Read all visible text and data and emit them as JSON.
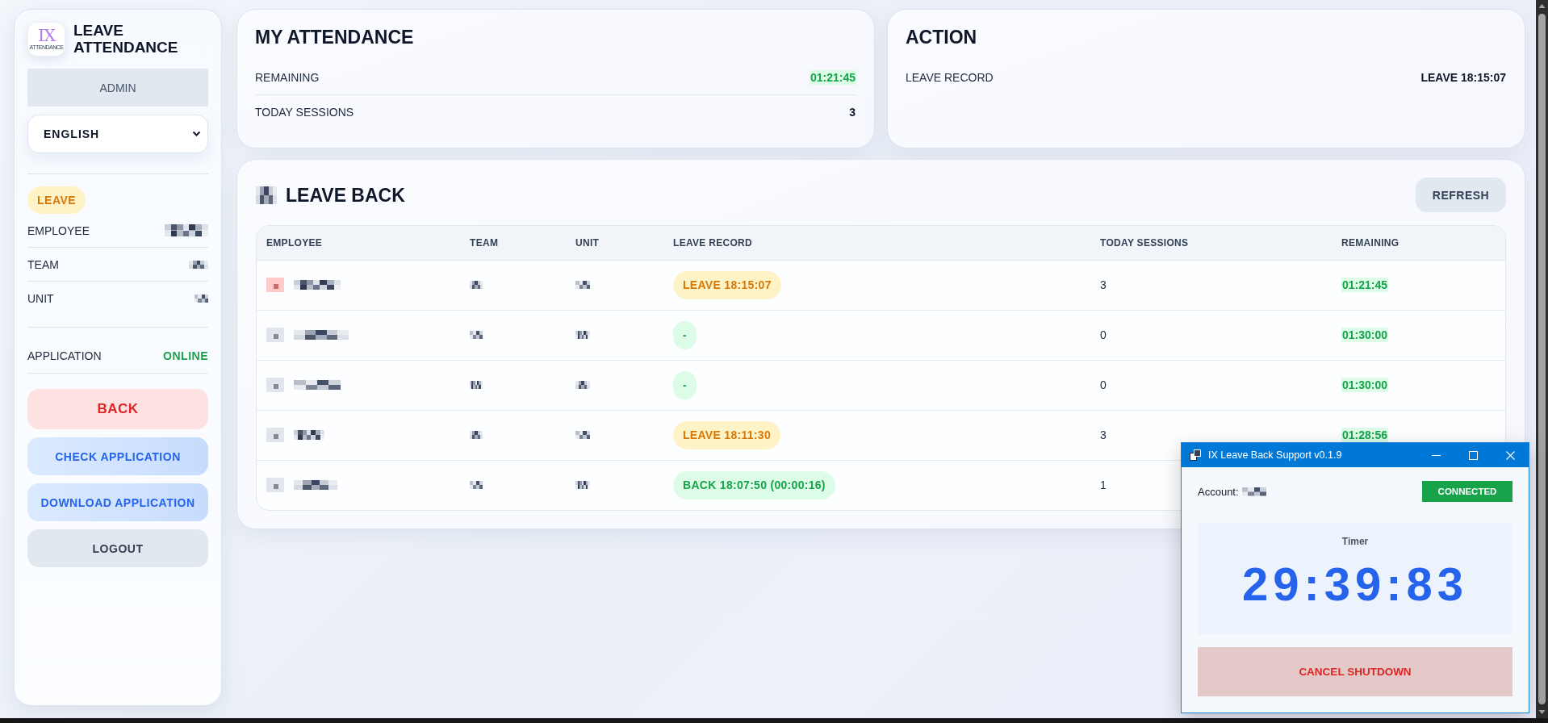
{
  "sidebar": {
    "logo": {
      "mark": "IX",
      "caption": "ATTENDANCE"
    },
    "title": "LEAVE ATTENDANCE",
    "role": "ADMIN",
    "language": "ENGLISH",
    "status_badge": {
      "label": "LEAVE",
      "kind": "leave"
    },
    "info_rows": [
      "EMPLOYEE",
      "TEAM",
      "UNIT"
    ],
    "application": {
      "label": "APPLICATION",
      "status": "ONLINE",
      "online": true
    },
    "buttons": [
      {
        "label": "BACK",
        "kind": "danger"
      },
      {
        "label": "CHECK APPLICATION",
        "kind": "primary"
      },
      {
        "label": "DOWNLOAD APPLICATION",
        "kind": "primary"
      },
      {
        "label": "LOGOUT",
        "kind": "neutral"
      }
    ]
  },
  "my_attendance": {
    "title": "MY ATTENDANCE",
    "rows": [
      {
        "label": "REMAINING",
        "value": "01:21:45",
        "kind": "time"
      },
      {
        "label": "TODAY SESSIONS",
        "value": "3",
        "kind": "count"
      }
    ]
  },
  "action": {
    "title": "ACTION",
    "rows": [
      {
        "label": "LEAVE RECORD",
        "value": "LEAVE 18:15:07",
        "kind": "text"
      }
    ]
  },
  "leave_back": {
    "title": "LEAVE BACK",
    "refresh_button": "REFRESH",
    "table": {
      "columns": [
        "EMPLOYEE",
        "TEAM",
        "UNIT",
        "LEAVE RECORD",
        "TODAY SESSIONS",
        "REMAINING"
      ],
      "rows": [
        {
          "avatar": {
            "color": "#fecaca"
          },
          "leave_record": {
            "text": "LEAVE 18:15:07",
            "kind": "leave"
          },
          "today_sessions": "3",
          "remaining": "01:21:45"
        },
        {
          "avatar": {
            "color": "#e2e5ec"
          },
          "leave_record": {
            "text": "-",
            "kind": "none"
          },
          "today_sessions": "0",
          "remaining": "01:30:00"
        },
        {
          "avatar": {
            "color": "#e2e5ec"
          },
          "leave_record": {
            "text": "-",
            "kind": "none"
          },
          "today_sessions": "0",
          "remaining": "01:30:00"
        },
        {
          "avatar": {
            "color": "#e2e5ec"
          },
          "leave_record": {
            "text": "LEAVE 18:11:30",
            "kind": "leave"
          },
          "today_sessions": "3",
          "remaining": "01:28:56"
        },
        {
          "avatar": {
            "color": "#e2e5ec"
          },
          "leave_record": {
            "text": "BACK 18:07:50 (00:00:16)",
            "kind": "back"
          },
          "today_sessions": "1"
        }
      ]
    }
  },
  "support_window": {
    "title": "IX Leave Back Support v0.1.9",
    "account_label": "Account:",
    "connection": {
      "label": "CONNECTED",
      "connected": true
    },
    "timer": {
      "label": "Timer",
      "value": "29:39:83"
    },
    "cancel_button": "CANCEL SHUTDOWN"
  }
}
